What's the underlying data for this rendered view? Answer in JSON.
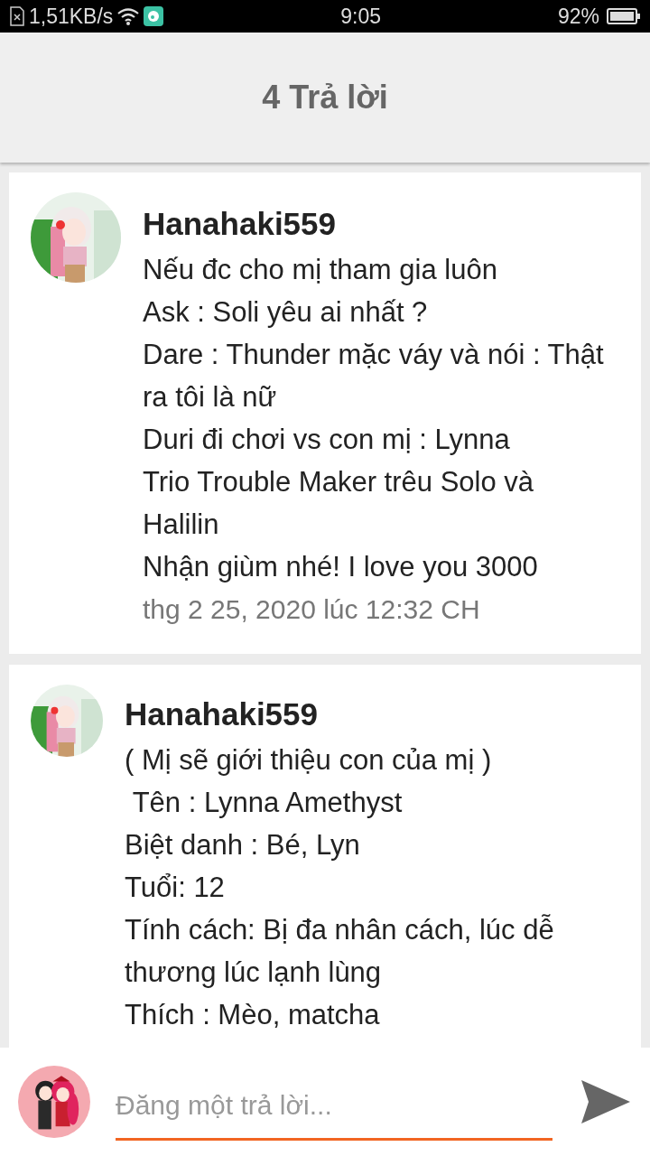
{
  "status_bar": {
    "speed": "1,51KB/s",
    "time": "9:05",
    "battery": "92%"
  },
  "header": {
    "title": "4 Trả lời"
  },
  "replies": [
    {
      "author": "Hanahaki559",
      "kind": "large",
      "lines": [
        "Nếu đc cho mị tham gia luôn",
        "Ask : Soli yêu ai nhất ?",
        "Dare : Thunder mặc váy và nói : Thật ra tôi là nữ",
        "Duri đi chơi vs con mị : Lynna",
        "Trio Trouble Maker trêu Solo và Halilin",
        "Nhận giùm nhé! I love you 3000"
      ],
      "date": "thg 2 25, 2020 lúc 12:32 CH"
    },
    {
      "author": "Hanahaki559",
      "kind": "small",
      "lines": [
        "( Mị sẽ giới thiệu con của mị )",
        " Tên : Lynna Amethyst",
        "Biệt danh : Bé, Lyn",
        "Tuổi: 12",
        "Tính cách: Bị đa nhân cách, lúc dễ thương lúc lạnh lùng",
        "Thích : Mèo, matcha"
      ]
    }
  ],
  "composer": {
    "placeholder": "Đăng một trả lời..."
  }
}
